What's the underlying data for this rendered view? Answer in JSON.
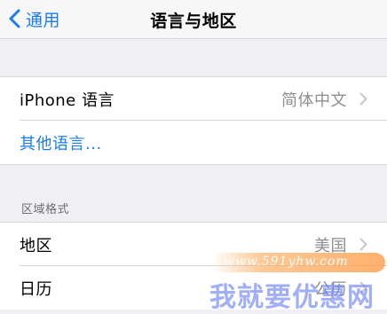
{
  "nav": {
    "back_label": "通用",
    "title": "语言与地区"
  },
  "language_group": {
    "iphone_language": {
      "label": "iPhone 语言",
      "value": "简体中文"
    },
    "other_languages": {
      "label": "其他语言..."
    }
  },
  "region_format": {
    "header": "区域格式",
    "region": {
      "label": "地区",
      "value": "美国"
    },
    "calendar": {
      "label": "日历",
      "value": "公历"
    }
  },
  "watermark": {
    "url": "www.591yhw.com",
    "brand": "我就要优惠网"
  },
  "colors": {
    "accent": "#1a7bf2",
    "background": "#efeff4",
    "secondary_text": "#8e8e93"
  }
}
